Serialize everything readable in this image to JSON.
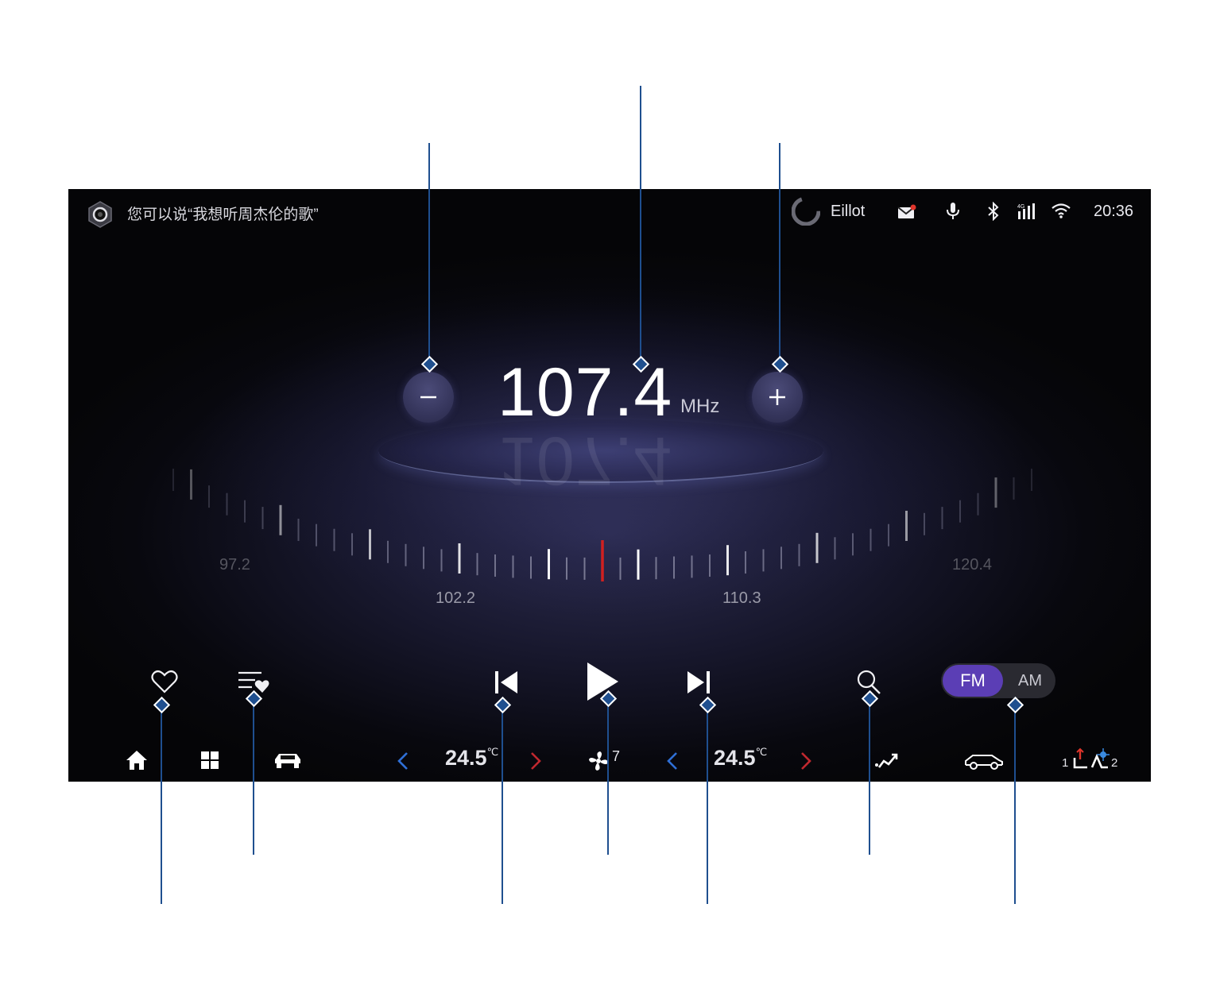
{
  "status_bar": {
    "voice_hint": "您可以说“我想听周杰伦的歌”",
    "username": "Eillot",
    "time": "20:36"
  },
  "radio": {
    "frequency": "107.4",
    "unit": "MHz",
    "dial_labels": [
      "97.2",
      "102.2",
      "110.3",
      "120.4"
    ],
    "band_fm": "FM",
    "band_am": "AM",
    "selected_band": "FM"
  },
  "climate": {
    "left_temp": "24.5",
    "right_temp": "24.5",
    "temp_unit": "℃",
    "fan_speed": "7",
    "seat_left_num": "1",
    "seat_right_num": "2"
  },
  "colors": {
    "accent": "#5b3eb5",
    "needle": "#d02020",
    "arrow_left": "#2f6fd6",
    "arrow_right": "#c0282f",
    "callout": "#1f4f8f"
  },
  "icons": [
    "assistant-icon",
    "avatar-icon",
    "mail-icon",
    "mic-icon",
    "bluetooth-icon",
    "signal-icon",
    "wifi-icon",
    "minus-icon",
    "plus-icon",
    "heart-icon",
    "favorites-list-icon",
    "previous-icon",
    "play-icon",
    "next-icon",
    "search-icon",
    "home-icon",
    "apps-grid-icon",
    "car-icon",
    "fan-icon",
    "airflow-icon",
    "car-outline-icon",
    "seat-heat-icon"
  ]
}
